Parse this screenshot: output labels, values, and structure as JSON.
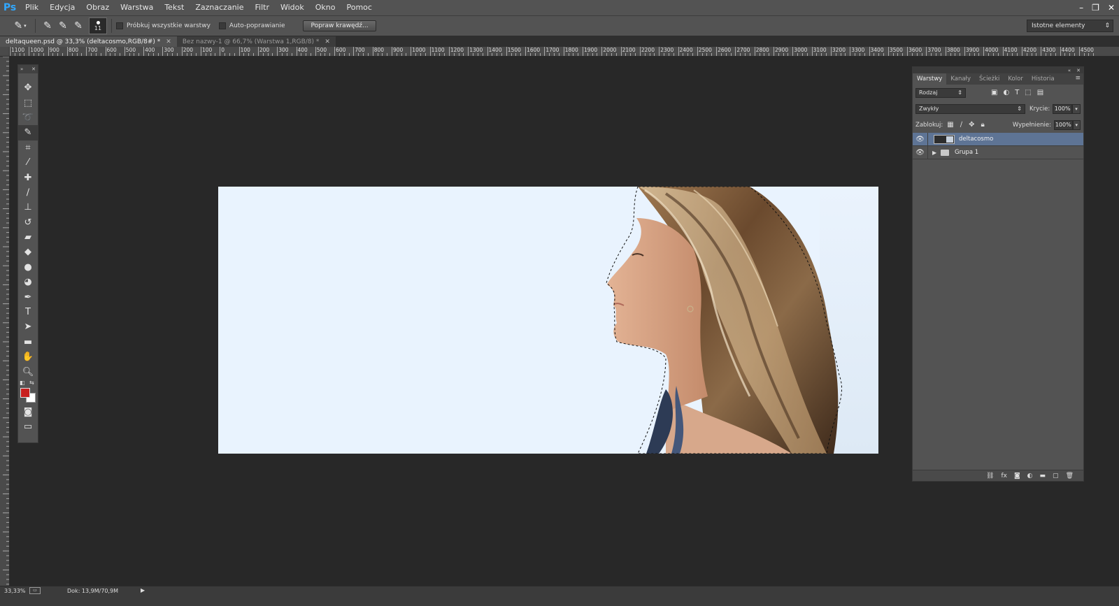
{
  "app": {
    "logo": "Ps"
  },
  "menu": [
    "Plik",
    "Edycja",
    "Obraz",
    "Warstwa",
    "Tekst",
    "Zaznaczanie",
    "Filtr",
    "Widok",
    "Okno",
    "Pomoc"
  ],
  "window_controls": {
    "minimize": "–",
    "restore": "❐",
    "close": "✕"
  },
  "options": {
    "brush_size": "11",
    "sample_all_layers": "Próbkuj wszystkie warstwy",
    "auto_enhance": "Auto-poprawianie",
    "refine_edge": "Popraw krawędź...",
    "workspace": "Istotne elementy"
  },
  "tabs": [
    {
      "label": "deltaqueen.psd @ 33,3% (deltacosmo,RGB/8#) *",
      "active": true
    },
    {
      "label": "Bez nazwy-1 @ 66,7% (Warstwa 1,RGB/8) *",
      "active": false
    }
  ],
  "ruler_top_labels": [
    "1100",
    "1000",
    "900",
    "800",
    "700",
    "600",
    "500",
    "400",
    "300",
    "200",
    "100",
    "0",
    "100",
    "200",
    "300",
    "400",
    "500",
    "600",
    "700",
    "800",
    "900",
    "1000",
    "1100",
    "1200",
    "1300",
    "1400",
    "1500",
    "1600",
    "1700",
    "1800",
    "1900",
    "2000",
    "2100",
    "2200",
    "2300",
    "2400",
    "2500",
    "2600",
    "2700",
    "2800",
    "2900",
    "3000",
    "3100",
    "3200",
    "3300",
    "3400",
    "3500",
    "3600",
    "3700",
    "3800",
    "3900",
    "4000",
    "4100",
    "4200",
    "4300",
    "4400",
    "4500"
  ],
  "layers_panel": {
    "tabs": [
      "Warstwy",
      "Kanały",
      "Ścieżki",
      "Kolor",
      "Historia"
    ],
    "filter": "Rodzaj",
    "blend_mode": "Zwykły",
    "opacity_label": "Krycie:",
    "opacity": "100%",
    "lock_label": "Zablokuj:",
    "fill_label": "Wypełnienie:",
    "fill": "100%",
    "layers": [
      {
        "name": "deltacosmo",
        "selected": true,
        "type": "layer"
      },
      {
        "name": "Grupa 1",
        "selected": false,
        "type": "group"
      }
    ]
  },
  "status": {
    "zoom": "33,33%",
    "doc": "Dok: 13,9M/70,9M"
  },
  "colors": {
    "foreground": "#c8201f",
    "background": "#ffffff",
    "canvas_bg": "#e9f3fe",
    "accent": "#31a8ff",
    "selected_layer": "#5e7495"
  }
}
